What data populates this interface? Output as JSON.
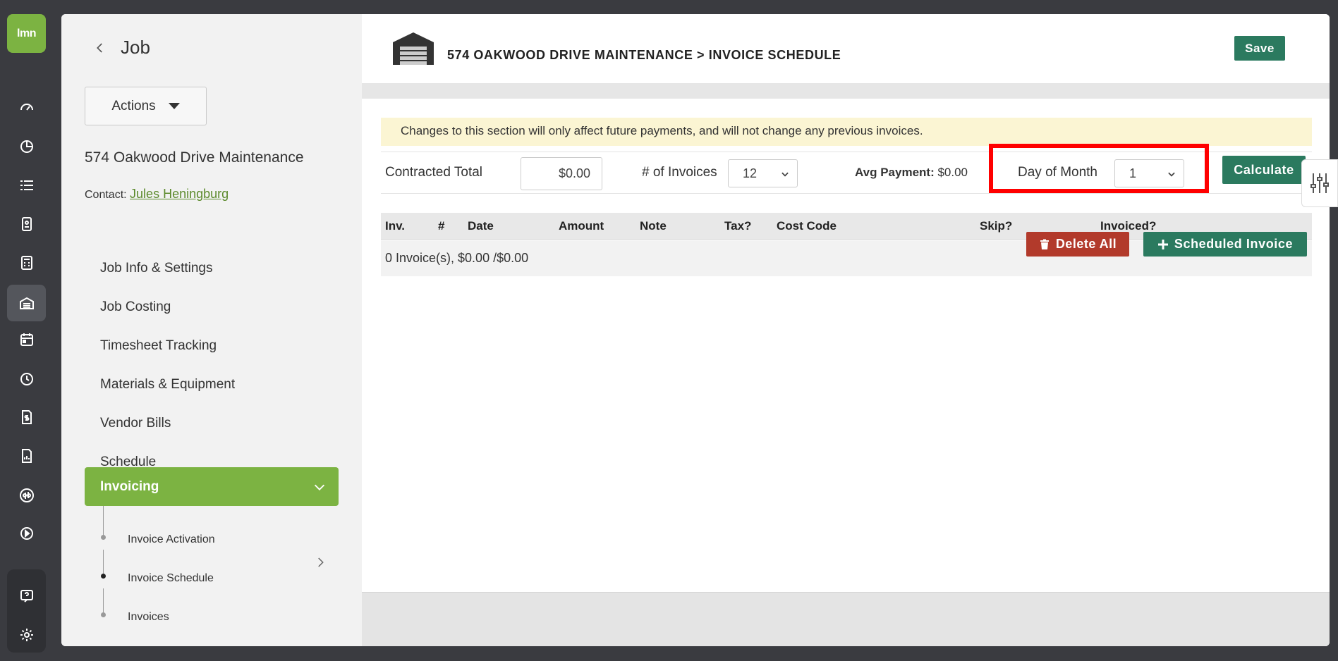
{
  "app": {
    "logo_text": "lmn"
  },
  "rail": {
    "icons": [
      "speedometer-icon",
      "pie-chart-icon",
      "list-icon",
      "contact-card-icon",
      "calculator-icon",
      "jobs-garage-icon",
      "calendar-icon",
      "clock-icon",
      "invoice-dollar-icon",
      "report-icon",
      "quickbooks-icon",
      "play-icon",
      "help-icon",
      "gear-icon"
    ]
  },
  "sidebar": {
    "title": "Job",
    "actions_label": "Actions",
    "job_name": "574 Oakwood Drive Maintenance",
    "contact_label": "Contact:",
    "contact_name": "Jules Heningburg",
    "nav": [
      "Job Info & Settings",
      "Job Costing",
      "Timesheet Tracking",
      "Materials & Equipment",
      "Vendor Bills",
      "Schedule"
    ],
    "active_nav": "Invoicing",
    "sub_nav": [
      "Invoice Activation",
      "Invoice Schedule",
      "Invoices"
    ]
  },
  "header": {
    "title": "574 OAKWOOD DRIVE MAINTENANCE > INVOICE SCHEDULE",
    "save_label": "Save"
  },
  "notice": "Changes to this section will only affect future payments, and will not change any previous invoices.",
  "controls": {
    "contracted_total_label": "Contracted Total",
    "contracted_total_value": "$0.00",
    "num_invoices_label": "# of Invoices",
    "num_invoices_value": "12",
    "avg_payment_label": "Avg Payment:",
    "avg_payment_value": "$0.00",
    "day_of_month_label": "Day of Month",
    "day_of_month_value": "1",
    "calculate_label": "Calculate"
  },
  "table": {
    "columns": [
      "Inv.",
      "#",
      "Date",
      "Amount",
      "Note",
      "Tax?",
      "Cost Code",
      "Skip?",
      "Invoiced?"
    ],
    "summary": "0 Invoice(s), $0.00 /$0.00",
    "delete_all_label": "Delete All",
    "add_label": "Scheduled Invoice"
  },
  "colors": {
    "brand_green": "#7cb342",
    "action_green": "#2b7a5f",
    "danger_red": "#b23a2b",
    "highlight_red": "#ff0000",
    "notice_bg": "#fbf5d3"
  }
}
